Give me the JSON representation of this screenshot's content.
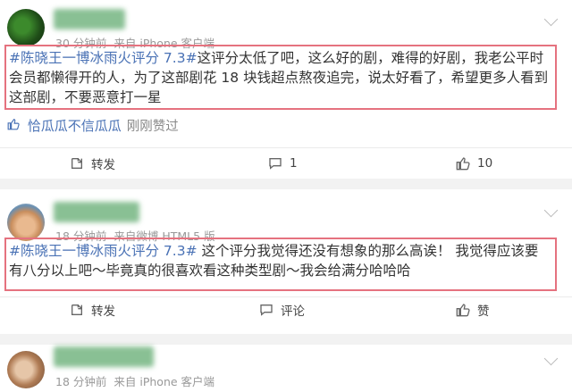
{
  "posts": [
    {
      "meta_time": "30 分钟前",
      "meta_source": "来自 iPhone 客户端",
      "content_tag": "#陈晓王一博冰雨火评分 7.3#",
      "content_body": "这评分太低了吧，这么好的剧，难得的好剧，我老公平时会员都懒得开的人，为了这部剧花 18 块钱超点熬夜追完，说太好看了，希望更多人看到这部剧，不要恶意打一星",
      "liked_names": "恰瓜瓜不信瓜瓜",
      "liked_suffix": "刚刚赞过",
      "actions": {
        "repost": "转发",
        "comment": "1",
        "like": "10"
      }
    },
    {
      "meta_time": "18 分钟前",
      "meta_source": "来自微博 HTML5 版",
      "content_tag": "#陈晓王一博冰雨火评分 7.3#",
      "content_body": " 这个评分我觉得还没有想象的那么高诶！ 我觉得应该要有八分以上吧～毕竟真的很喜欢看这种类型剧～我会给满分哈哈哈",
      "actions": {
        "repost": "转发",
        "comment": "评论",
        "like": "赞"
      }
    },
    {
      "meta_time": "18 分钟前",
      "meta_source": "来自 iPhone 客户端"
    }
  ],
  "icons": [
    "thumb-up-icon",
    "repost-icon",
    "comment-icon",
    "chevron-down-icon"
  ],
  "colors": {
    "highlight_border": "#e5727f",
    "link_blue": "#4a72b5",
    "meta_gray": "#999999"
  }
}
